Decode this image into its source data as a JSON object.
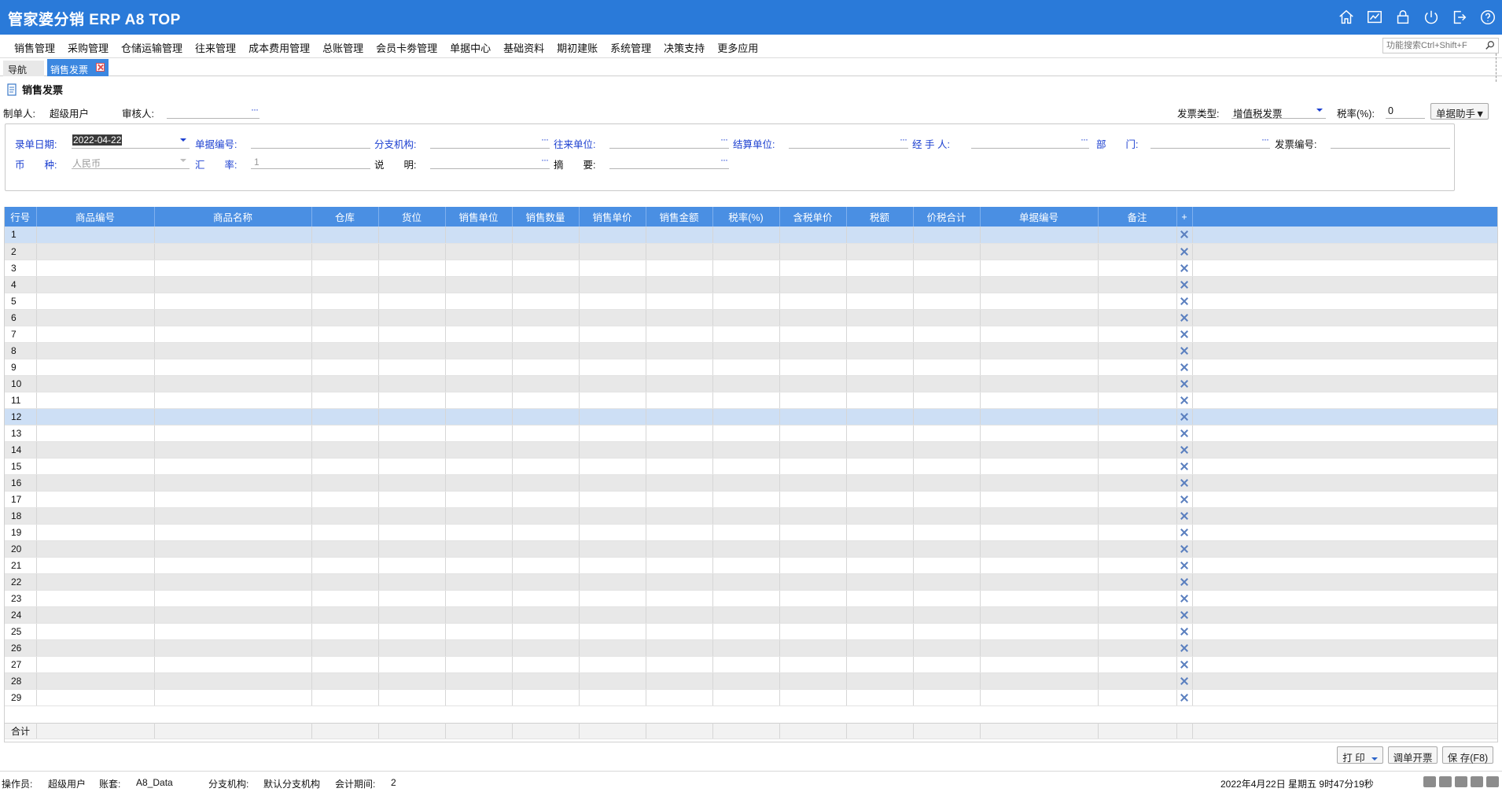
{
  "app": {
    "title": "管家婆分销 ERP A8 TOP"
  },
  "title_icons": [
    "home-icon",
    "chart-icon",
    "lock-icon",
    "power-icon",
    "exit-icon",
    "help-icon"
  ],
  "menu": [
    "销售管理",
    "采购管理",
    "仓储运输管理",
    "往来管理",
    "成本费用管理",
    "总账管理",
    "会员卡劵管理",
    "单据中心",
    "基础资料",
    "期初建账",
    "系统管理",
    "决策支持",
    "更多应用"
  ],
  "func_search": {
    "placeholder": "功能搜索Ctrl+Shift+F"
  },
  "tabs": {
    "nav": "导航",
    "active": "销售发票"
  },
  "doc": {
    "title": "销售发票"
  },
  "top": {
    "maker_label": "制单人:",
    "maker_value": "超级用户",
    "reviewer_label": "审核人:",
    "reviewer_dots": "···",
    "invoice_type_label": "发票类型:",
    "invoice_type_value": "增值税发票",
    "tax_rate_label": "税率(%):",
    "tax_rate_value": "0",
    "helper_button": "单据助手▼"
  },
  "fields": {
    "date_label": "录单日期:",
    "date_value": "2022-04-22",
    "bill_no_label": "单据编号:",
    "branch_label": "分支机构:",
    "partner_label": "往来单位:",
    "settle_label": "结算单位:",
    "handler_label": "经 手 人:",
    "dept_label": "部　　门:",
    "invoice_no_label": "发票编号:",
    "currency_label": "币　　种:",
    "currency_value": "人民币",
    "rate_label": "汇　　率:",
    "rate_value": "1",
    "note_label": "说　　明:",
    "summary_label": "摘　　要:",
    "dots": "···"
  },
  "grid": {
    "columns": [
      "行号",
      "商品编号",
      "商品名称",
      "仓库",
      "货位",
      "销售单位",
      "销售数量",
      "销售单价",
      "销售金额",
      "税率(%)",
      "含税单价",
      "税额",
      "价税合计",
      "单据编号",
      "备注",
      "+"
    ],
    "rows": [
      "1",
      "2",
      "3",
      "4",
      "5",
      "6",
      "7",
      "8",
      "9",
      "10",
      "11",
      "12",
      "13",
      "14",
      "15",
      "16",
      "17",
      "18",
      "19",
      "20",
      "21",
      "22",
      "23",
      "24",
      "25",
      "26",
      "27",
      "28",
      "29"
    ],
    "total_label": "合计"
  },
  "buttons": {
    "print": "打 印",
    "adjust": "调单开票",
    "save": "保 存(F8)"
  },
  "status": {
    "operator_label": "操作员:",
    "operator_value": "超级用户",
    "account_label": "账套:",
    "account_value": "A8_Data",
    "branch_label": "分支机构:",
    "branch_value": "默认分支机构",
    "period_label": "会计期间:",
    "period_value": "2",
    "datetime": "2022年4月22日  星期五  9时47分19秒"
  },
  "colors": {
    "titlebar": "#2a7ad9",
    "grid_header": "#4a8fe3",
    "selected_row": "#cddff5",
    "label_blue": "#1b3fd0"
  }
}
